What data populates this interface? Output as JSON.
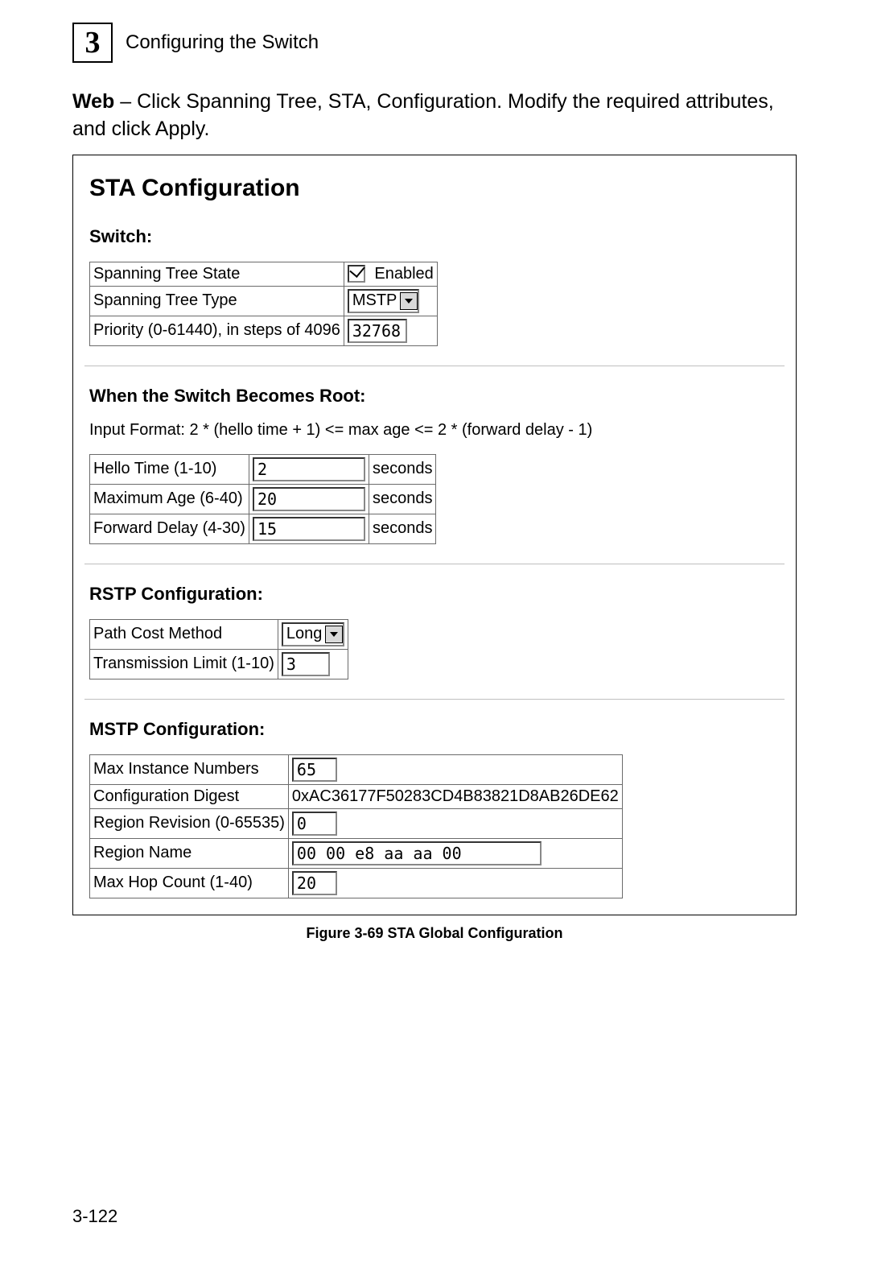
{
  "header": {
    "chapter_number": "3",
    "chapter_title": "Configuring the Switch"
  },
  "intro": {
    "lead": "Web",
    "rest": " – Click Spanning Tree, STA, Configuration. Modify the required attributes, and click Apply."
  },
  "panel": {
    "title": "STA Configuration",
    "switch": {
      "section": "Switch:",
      "rows": {
        "state_label": "Spanning Tree State",
        "state_checkbox_label": "Enabled",
        "type_label": "Spanning Tree Type",
        "type_value": "MSTP",
        "priority_label": "Priority (0-61440), in steps of 4096",
        "priority_value": "32768"
      }
    },
    "root": {
      "section": "When the Switch Becomes Root:",
      "note": "Input Format: 2 * (hello time + 1) <= max age <= 2 * (forward delay - 1)",
      "rows": {
        "hello_label": "Hello Time (1-10)",
        "hello_value": "2",
        "hello_unit": "seconds",
        "maxage_label": "Maximum Age (6-40)",
        "maxage_value": "20",
        "maxage_unit": "seconds",
        "fwd_label": "Forward Delay (4-30)",
        "fwd_value": "15",
        "fwd_unit": "seconds"
      }
    },
    "rstp": {
      "section": "RSTP Configuration:",
      "rows": {
        "pcm_label": "Path Cost Method",
        "pcm_value": "Long",
        "txlim_label": "Transmission Limit (1-10)",
        "txlim_value": "3"
      }
    },
    "mstp": {
      "section": "MSTP Configuration:",
      "rows": {
        "maxinst_label": "Max Instance Numbers",
        "maxinst_value": "65",
        "digest_label": "Configuration Digest",
        "digest_value": "0xAC36177F50283CD4B83821D8AB26DE62",
        "rev_label": "Region Revision (0-65535)",
        "rev_value": "0",
        "name_label": "Region Name",
        "name_value": "00 00 e8 aa aa 00",
        "hop_label": "Max Hop Count (1-40)",
        "hop_value": "20"
      }
    }
  },
  "figure_caption": "Figure 3-69   STA Global Configuration",
  "page_number": "3-122"
}
